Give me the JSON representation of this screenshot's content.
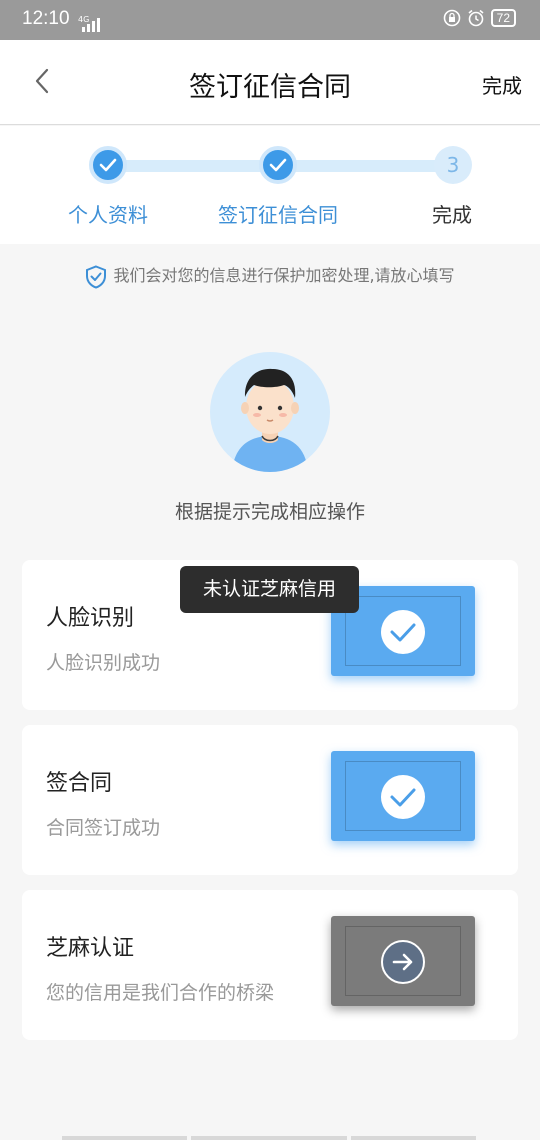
{
  "status_bar": {
    "time": "12:10",
    "network": "4G",
    "battery": "72"
  },
  "nav": {
    "title": "签订征信合同",
    "done_label": "完成"
  },
  "steps": [
    {
      "label": "个人资料",
      "state": "done"
    },
    {
      "label": "签订征信合同",
      "state": "done"
    },
    {
      "label": "完成",
      "state": "todo",
      "number": "3"
    }
  ],
  "notice": "我们会对您的信息进行保护加密处理,请放心填写",
  "hint": "根据提示完成相应操作",
  "cards": [
    {
      "title": "人脸识别",
      "subtitle": "人脸识别成功",
      "status": "done"
    },
    {
      "title": "签合同",
      "subtitle": "合同签订成功",
      "status": "done"
    },
    {
      "title": "芝麻认证",
      "subtitle": "您的信用是我们合作的桥梁",
      "status": "pending"
    }
  ],
  "toast": "未认证芝麻信用",
  "colors": {
    "accent": "#3d9ae8",
    "card_done": "#5aaaf0",
    "card_pending": "#7b7b7b",
    "status_bar": "#9a9a9a"
  }
}
